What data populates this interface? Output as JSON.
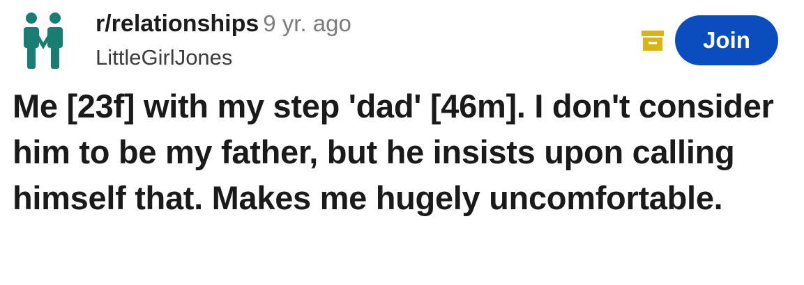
{
  "post": {
    "community": "r/relationships",
    "age": "9 yr. ago",
    "author": "LittleGirlJones",
    "join_label": "Join",
    "title": "Me [23f] with my step 'dad' [46m]. I don't consider him to be my father, but he insists upon calling himself that. Makes me hugely uncomfortable."
  },
  "icons": {
    "community_avatar": "two-people-icon",
    "archive": "archive-box-icon"
  },
  "colors": {
    "avatar": "#1a7d74",
    "archive": "#d9b415",
    "join_button": "#0b4dbf",
    "meta_gray": "#7c7c7c"
  }
}
